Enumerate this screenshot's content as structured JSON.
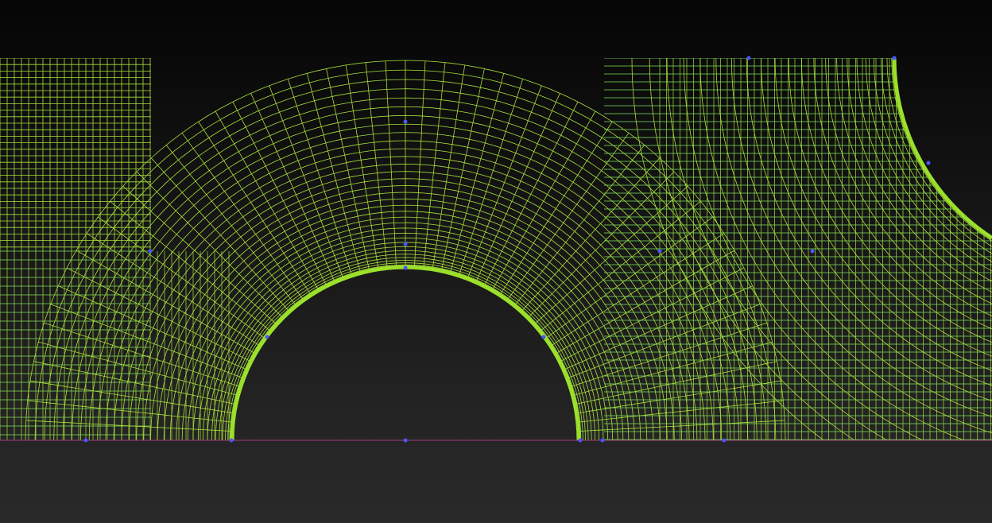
{
  "viewport": {
    "kind": "structured-quad-mesh-view",
    "mesh_color": "#a8e03a",
    "mesh_color_inner": "#7fe05a",
    "wall_color": "#9be02a",
    "vertex_color": "#4a55ff",
    "boundary_line_color": "#a03a7a",
    "background_top": "#050505",
    "background_bottom": "#2a2a2a"
  }
}
